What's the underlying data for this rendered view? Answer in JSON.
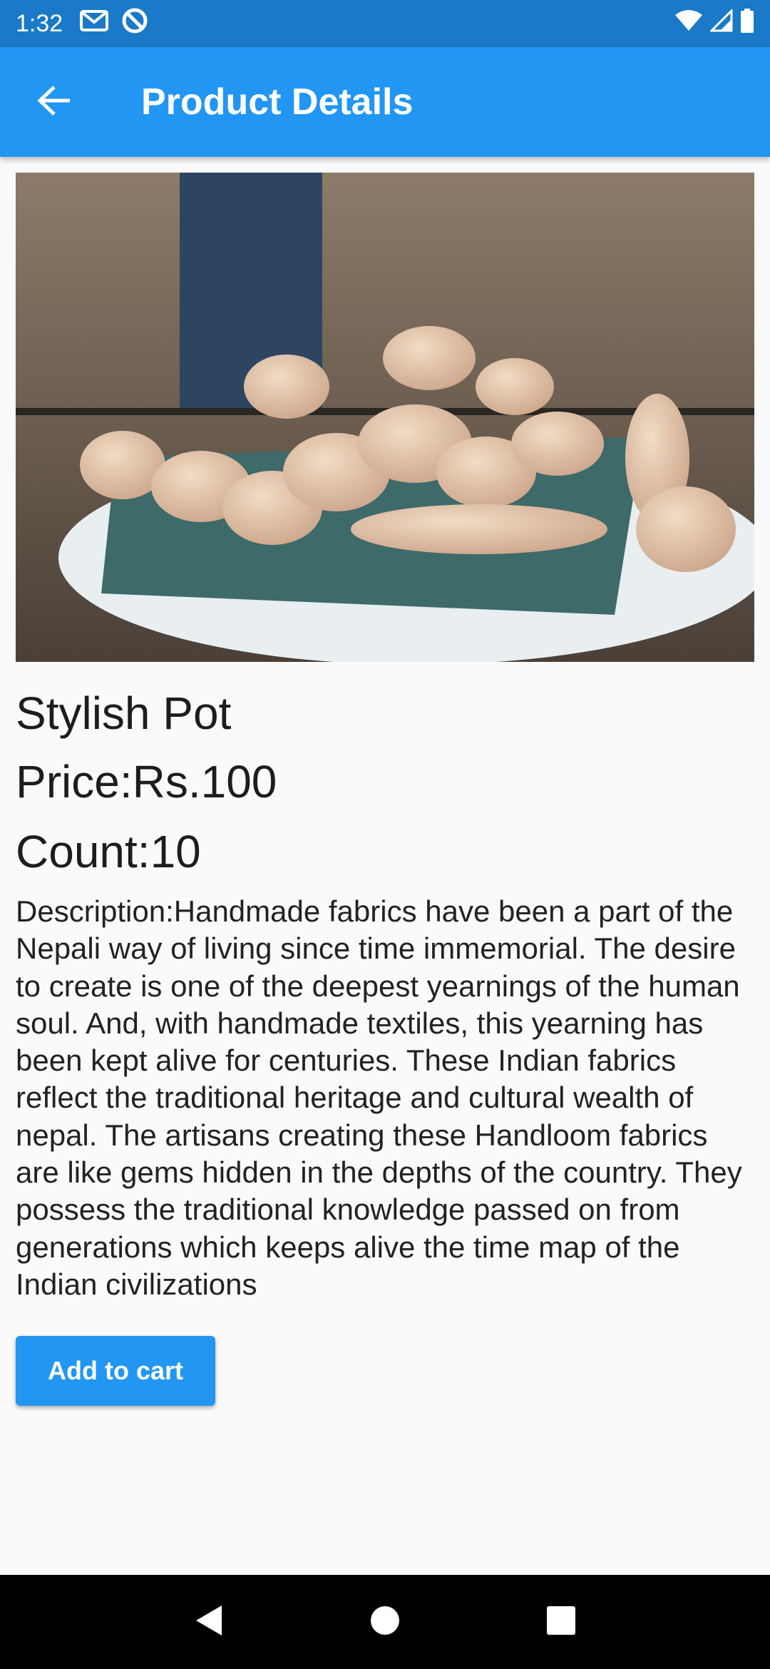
{
  "status_bar": {
    "time": "1:32",
    "left_icons": [
      "gmail-icon",
      "at-sign-icon"
    ],
    "right_icons": [
      "wifi-icon",
      "signal-icon",
      "battery-icon"
    ]
  },
  "app_bar": {
    "back_icon": "arrow-left-icon",
    "title": "Product Details"
  },
  "product": {
    "image_alt": "pottery",
    "name": "Stylish Pot",
    "price": "Price:Rs.100",
    "count": "Count:10",
    "description": "Description:Handmade fabrics have been a part of the Nepali way of living since time immemorial. The desire to create is one of the deepest yearnings of the human soul. And, with handmade textiles, this yearning has been kept alive for centuries. These Indian fabrics reflect the traditional heritage and cultural wealth of nepal. The artisans creating these Handloom fabrics are like gems hidden in the depths of the country. They possess the traditional knowledge passed on from generations which keeps alive the time map of the Indian civilizations"
  },
  "actions": {
    "add_to_cart": "Add to cart"
  },
  "nav_bar": {
    "icons": [
      "back-triangle-icon",
      "home-circle-icon",
      "recents-square-icon"
    ]
  },
  "colors": {
    "status_bar": "#1a79c9",
    "app_bar": "#2196f3",
    "button": "#2196f3",
    "background": "#fafafa",
    "nav_bar": "#000000"
  }
}
